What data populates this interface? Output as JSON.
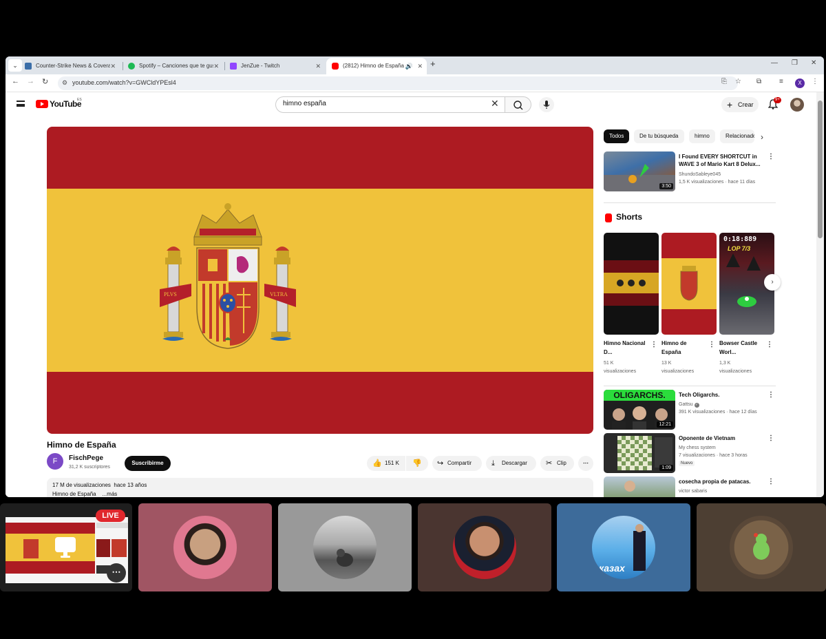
{
  "browser": {
    "tabs": [
      {
        "title": "Counter-Strike News & Coverage",
        "favicon_color": "#3b6ea8",
        "active": false
      },
      {
        "title": "Spotify – Canciones que te gusten",
        "favicon_color": "#1db954",
        "active": false
      },
      {
        "title": "JenZue - Twitch",
        "favicon_color": "#9146ff",
        "active": false
      },
      {
        "title": "(2812) Himno de España - YouTube",
        "favicon_color": "#ff0000",
        "active": true
      }
    ],
    "url": "youtube.com/watch?v=GWCldYPEsl4"
  },
  "youtube": {
    "logo_text": "YouTube",
    "region": "ES",
    "search_query": "himno españa",
    "create_label": "Crear",
    "notif_count": "9+",
    "video": {
      "title": "Himno de España",
      "channel": "FischPege",
      "channel_initial": "F",
      "subscribers": "31,2 K suscriptores",
      "subscribe_label": "Suscribirme",
      "likes": "151 K",
      "share_label": "Compartir",
      "download_label": "Descargar",
      "clip_label": "Clip",
      "views": "17 M de visualizaciones",
      "age": "hace 13 años",
      "description": "Himno de España",
      "more_label": "...más",
      "motto_left": "PLVS",
      "motto_right": "VLTRA"
    },
    "chips": [
      "Todos",
      "De tu búsqueda",
      "himno",
      "Relacionados"
    ],
    "recommendations": [
      {
        "title": "I Found EVERY SHORTCUT in WAVE 3 of Mario Kart 8 Delux...",
        "channel": "ShundoSableye045",
        "views": "1,5 K visualizaciones",
        "age": "hace 11 días",
        "duration": "3:50"
      }
    ],
    "shorts_title": "Shorts",
    "shorts": [
      {
        "title": "Himno Nacional D...",
        "views": "51 K",
        "views_label": "visualizaciones"
      },
      {
        "title": "Himno de España",
        "views": "13 K",
        "views_label": "visualizaciones"
      },
      {
        "title": "Bowser Castle Worl...",
        "views": "1,3 K",
        "views_label": "visualizaciones",
        "overlay_top": "0:18:889",
        "overlay_bottom": "LOP 7/3"
      }
    ],
    "more_recs": [
      {
        "title": "Tech Oligarchs.",
        "channel": "Gattsu",
        "views": "391 K visualizaciones",
        "age": "hace 12 días",
        "duration": "12:21",
        "thumb_text": "OLIGARCHS."
      },
      {
        "title": "Oponente de Vietnam",
        "channel": "My chess system",
        "views": "7 visualizaciones",
        "age": "hace 3 horas",
        "duration": "1:09",
        "badge": "Nuevo"
      },
      {
        "title": "cosecha propia de patacas.",
        "channel": "victor sabaris"
      }
    ]
  },
  "call": {
    "live_label": "LIVE",
    "tiles": [
      {
        "bg": "#a05563"
      },
      {
        "bg": "#999999"
      },
      {
        "bg": "#4a3530"
      },
      {
        "bg": "#3d6b9a",
        "caption": "казах"
      },
      {
        "bg": "#4d3f33"
      }
    ]
  }
}
